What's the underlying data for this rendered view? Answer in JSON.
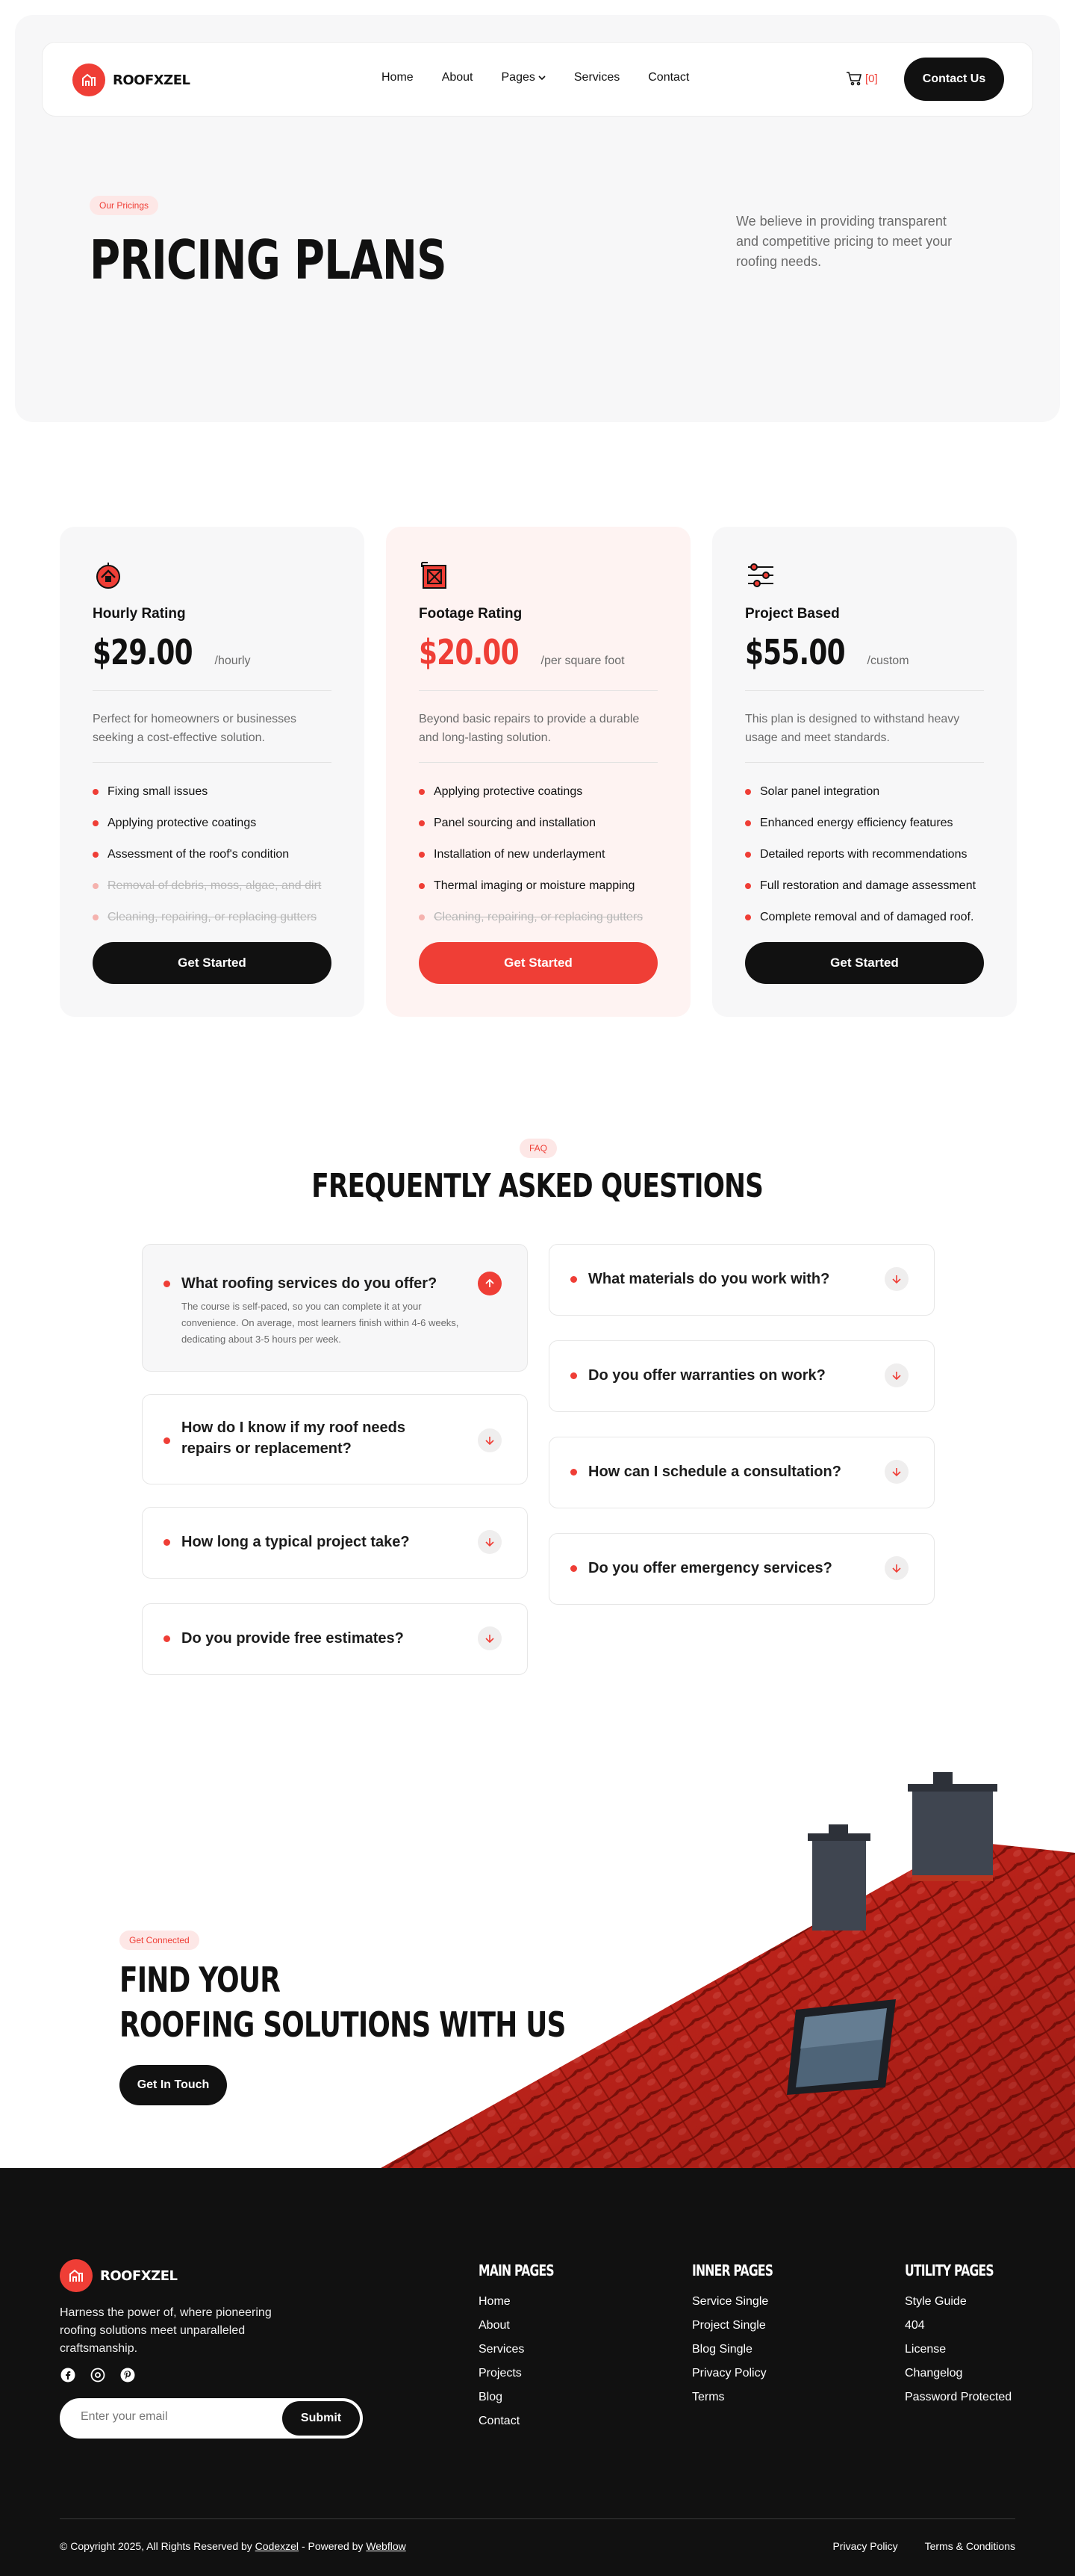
{
  "brand": {
    "name": "ROOFXZEL",
    "accent": "#ef3e36",
    "dark": "#111111"
  },
  "nav": {
    "links": [
      "Home",
      "About",
      "Pages",
      "Services",
      "Contact"
    ],
    "cart_count": "[0]",
    "contact_label": "Contact Us"
  },
  "hero": {
    "pill": "Our Pricings",
    "title": "PRICING PLANS",
    "description": "We believe in providing transparent and competitive pricing to meet your roofing needs."
  },
  "plans": [
    {
      "icon": "roof-badge-icon",
      "name": "Hourly Rating",
      "price": "$29.00",
      "unit": "/hourly",
      "description": "Perfect for homeowners or businesses seeking a cost-effective solution.",
      "features": [
        {
          "text": "Fixing small issues",
          "included": true
        },
        {
          "text": "Applying protective coatings",
          "included": true
        },
        {
          "text": "Assessment of the roof's condition",
          "included": true
        },
        {
          "text": "Removal of debris, moss, algae, and dirt",
          "included": false
        },
        {
          "text": "Cleaning, repairing, or replacing gutters",
          "included": false
        }
      ],
      "cta": "Get Started"
    },
    {
      "icon": "area-measure-icon",
      "name": "Footage Rating",
      "price": "$20.00",
      "unit": "/per square foot",
      "description": "Beyond basic repairs to provide a durable and long-lasting solution.",
      "features": [
        {
          "text": "Applying protective coatings",
          "included": true
        },
        {
          "text": "Panel sourcing and installation",
          "included": true
        },
        {
          "text": "Installation of new underlayment",
          "included": true
        },
        {
          "text": "Thermal imaging or moisture mapping",
          "included": true
        },
        {
          "text": "Cleaning, repairing, or replacing gutters",
          "included": false
        }
      ],
      "cta": "Get Started"
    },
    {
      "icon": "sliders-icon",
      "name": "Project Based",
      "price": "$55.00",
      "unit": "/custom",
      "description": "This plan is designed to withstand heavy usage and meet standards.",
      "features": [
        {
          "text": "Solar panel integration",
          "included": true
        },
        {
          "text": "Enhanced energy efficiency features",
          "included": true
        },
        {
          "text": "Detailed reports with recommendations",
          "included": true
        },
        {
          "text": "Full restoration and damage assessment",
          "included": true
        },
        {
          "text": "Complete removal and of damaged roof.",
          "included": true
        }
      ],
      "cta": "Get Started"
    }
  ],
  "faq": {
    "pill": "FAQ",
    "title": "FREQUENTLY ASKED QUESTIONS",
    "items": [
      {
        "q": "What roofing services do you offer?",
        "a": "The course is self-paced, so you can complete it at your convenience. On average, most learners finish within 4-6 weeks, dedicating about 3-5 hours per week.",
        "open": true
      },
      {
        "q": "What materials do you work with?",
        "open": false
      },
      {
        "q": "How do I know if my roof needs repairs or replacement?",
        "open": false
      },
      {
        "q": "Do you offer warranties on work?",
        "open": false
      },
      {
        "q": "How long a typical project take?",
        "open": false
      },
      {
        "q": "How can I schedule a consultation?",
        "open": false
      },
      {
        "q": "Do you provide free estimates?",
        "open": false
      },
      {
        "q": "Do you offer emergency services?",
        "open": false
      }
    ]
  },
  "cta_section": {
    "pill": "Get Connected",
    "title_line1": "FIND YOUR",
    "title_line2": "ROOFING SOLUTIONS WITH US",
    "button": "Get In Touch"
  },
  "footer": {
    "description": "Harness the power of, where pioneering roofing solutions meet unparalleled craftsmanship.",
    "social": [
      "facebook-icon",
      "dribbble-icon",
      "pinterest-icon"
    ],
    "email_placeholder": "Enter your email",
    "submit": "Submit",
    "columns": [
      {
        "title": "MAIN PAGES",
        "links": [
          "Home",
          "About",
          "Services",
          "Projects",
          "Blog",
          "Contact"
        ]
      },
      {
        "title": "INNER PAGES",
        "links": [
          "Service Single",
          "Project Single",
          "Blog Single",
          "Privacy Policy",
          "Terms"
        ]
      },
      {
        "title": "UTILITY PAGES",
        "links": [
          "Style Guide",
          "404",
          "License",
          "Changelog",
          "Password Protected"
        ]
      }
    ],
    "copyright_prefix": "© Copyright 2025, All Rights Reserved by",
    "copyright_link1": "Codexzel",
    "copyright_mid": "- Powered by",
    "copyright_link2": "Webflow",
    "legal": [
      "Privacy Policy",
      "Terms & Conditions"
    ]
  }
}
